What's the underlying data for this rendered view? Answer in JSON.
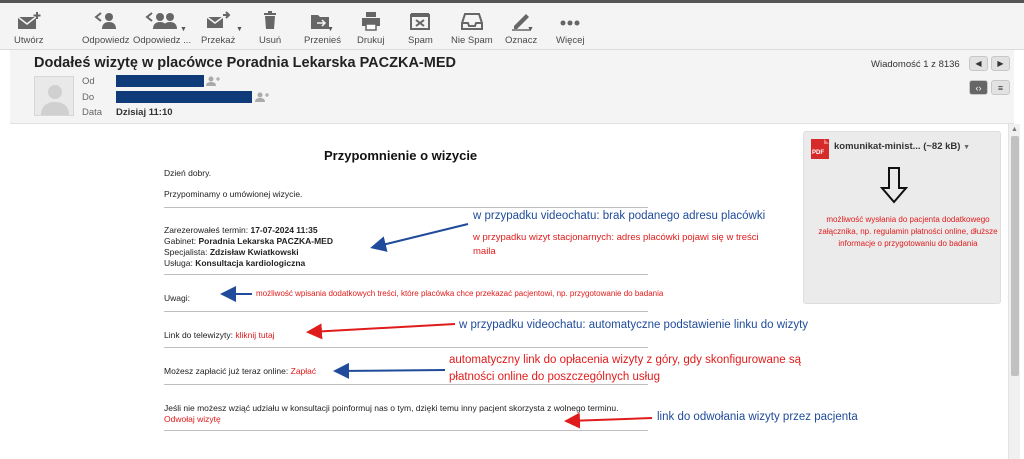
{
  "toolbar": {
    "compose": "Utwórz",
    "reply": "Odpowiedz",
    "reply_all": "Odpowiedz ...",
    "forward": "Przekaż",
    "delete": "Usuń",
    "move": "Przenieś",
    "print": "Drukuj",
    "spam": "Spam",
    "not_spam": "Nie Spam",
    "mark": "Oznacz",
    "more": "Więcej"
  },
  "header": {
    "subject": "Dodałeś wizytę w placówce Poradnia Lekarska PACZKA-MED",
    "from_label": "Od",
    "to_label": "Do",
    "date_label": "Data",
    "date_value": "Dzisiaj 11:10",
    "message_counter": "Wiadomość 1 z 8136"
  },
  "mail": {
    "title": "Przypomnienie o wizycie",
    "greeting": "Dzień dobry.",
    "intro": "Przypominamy o umówionej wizycie.",
    "term_label": "Zarezerowałeś termin:",
    "term_value": "17-07-2024 11:35",
    "office_label": "Gabinet:",
    "office_value": "Poradnia Lekarska PACZKA-MED",
    "specialist_label": "Specjalista:",
    "specialist_value": "Zdzisław Kwiatkowski",
    "service_label": "Usługa:",
    "service_value": "Konsultacja kardiologiczna",
    "notes_label": "Uwagi:",
    "tele_label": "Link do telewizyty:",
    "tele_link": "kliknij tutaj",
    "pay_label": "Możesz zapłacić już teraz online:",
    "pay_link": "Zapłać",
    "cancel_text": "Jeśli nie możesz wziąć udziału w konsultacji poinformuj nas o tym, dzięki temu inny pacjent skorzysta z wolnego terminu.",
    "cancel_link": "Odwołaj wizytę"
  },
  "annotations": {
    "video_no_address": "w przypadku videochatu: brak podanego adresu placówki",
    "stationary_address": "w przypadku wizyt stacjonarnych: adres placówki pojawi się w treści maila",
    "notes_info": "możliwość wpisania dodatkowych treści, które placówka chce przekazać pacjentowi, np. przygotowanie do badania",
    "video_link": "w przypadku videochatu: automatyczne podstawienie linku do wizyty",
    "payment_link": "automatyczny link do opłacenia wizyty z góry, gdy skonfigurowane są płatności online do poszczególnych usług",
    "cancel_link": "link do odwołania wizyty przez pacjenta"
  },
  "attachment": {
    "name": "komunikat-minist... (~82 kB)",
    "note": "możliwość wysłania do pacjenta dodatkowego załącznika, np. regulamin płatności online, dłuższe informacje o przygotowaniu do badania",
    "icon_text": "PDF"
  },
  "colors": {
    "annotation_blue": "#1f4b9a",
    "annotation_red": "#e01b1b",
    "redaction": "#0f3c78"
  }
}
